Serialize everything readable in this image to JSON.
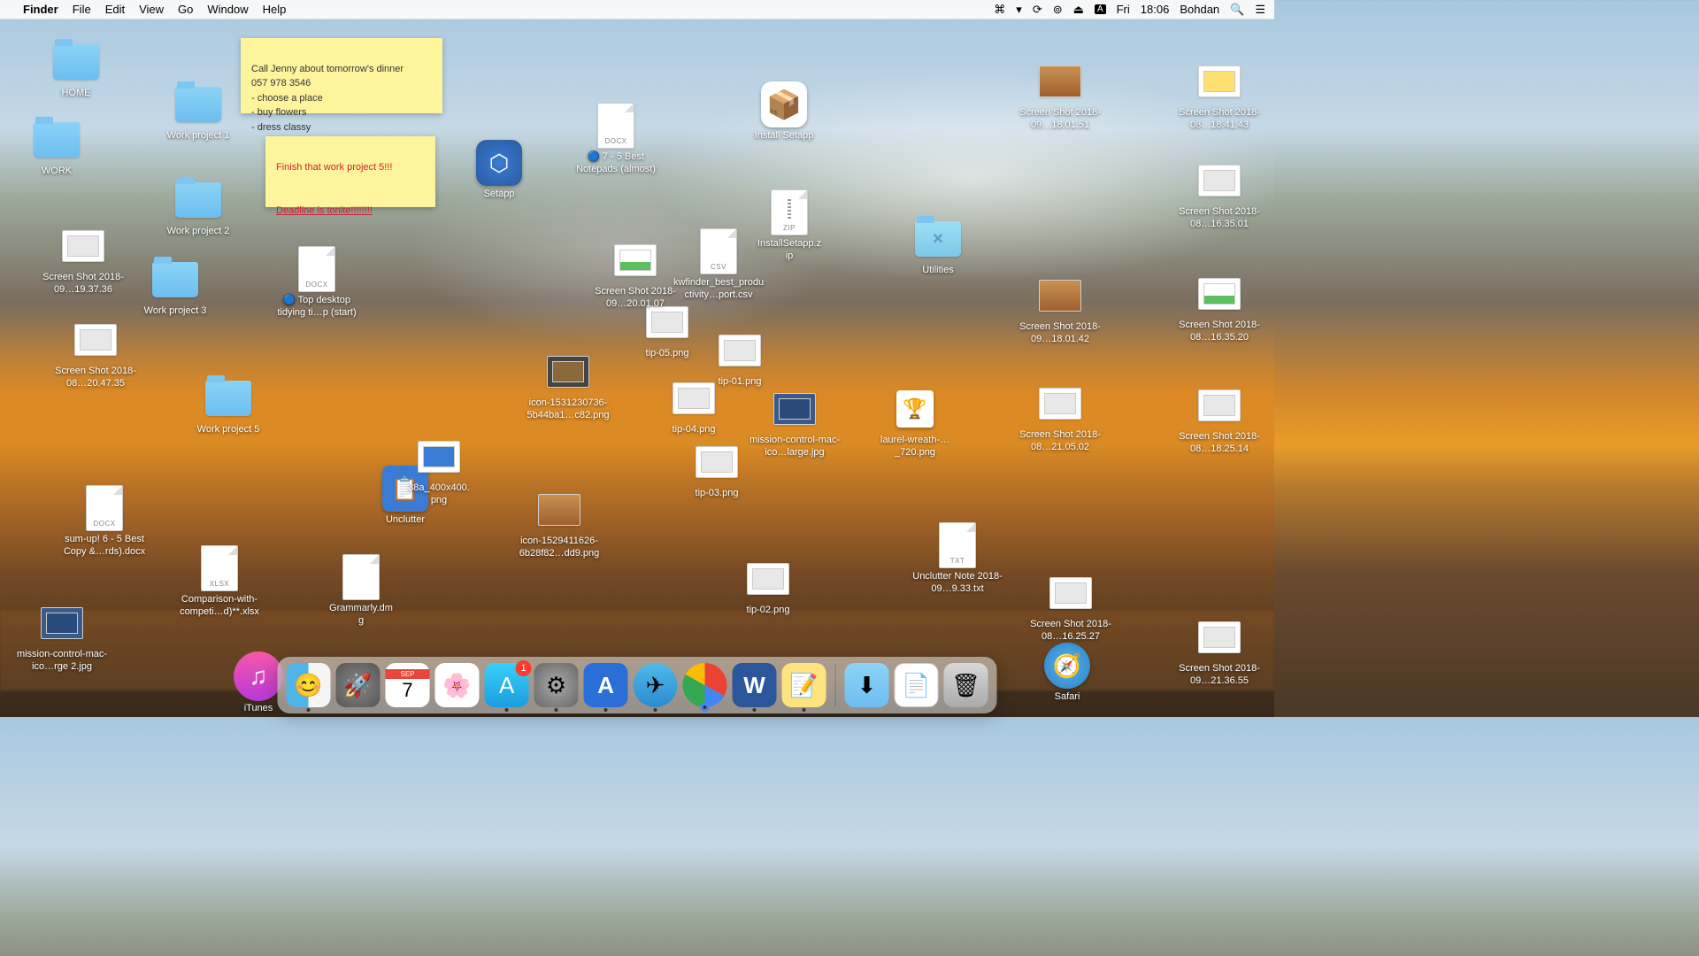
{
  "menubar": {
    "app": "Finder",
    "items": [
      "File",
      "Edit",
      "View",
      "Go",
      "Window",
      "Help"
    ],
    "day": "Fri",
    "time": "18:06",
    "user": "Bohdan",
    "input": "A"
  },
  "sticky1": "Call Jenny about tomorrow's dinner\n057 978 3546\n- choose a place\n- buy flowers\n- dress classy",
  "sticky2_line1": "Finish that work project 5!!!",
  "sticky2_line2": "Deadline is tonite!!!!!!!!",
  "folders": {
    "home": "HOME",
    "work": "WORK",
    "wp1": "Work project 1",
    "wp2": "Work project 2",
    "wp3": "Work project 3",
    "wp5": "Work project 5",
    "utilities": "Utilities"
  },
  "apps": {
    "setapp": "Setapp",
    "install_setapp": "Install Setapp",
    "unclutter": "Unclutter",
    "safari": "Safari",
    "itunes": "iTunes"
  },
  "files": {
    "notepads_docx": "🔵 7 - 5 Best Notepads (almost)",
    "top_desktop_docx": "🔵 Top desktop tidying ti…p (start)",
    "sumup_docx": "sum-up! 6 - 5 Best Copy &…rds).docx",
    "install_zip": "InstallSetapp.zip",
    "kwfinder_csv": "kwfinder_best_productivity…port.csv",
    "unclutter_txt": "Unclutter Note 2018-09…9.33.txt",
    "comparison_xlsx": "Comparison-with-competi…d)**.xlsx",
    "grammarly_dmg": "Grammarly.dmg",
    "a400_png": "38a_400x400.png",
    "icon1531_png": "icon-1531230736-5b44ba1…c82.png",
    "icon1529_png": "icon-1529411626-6b28f82…dd9.png",
    "tip01": "tip-01.png",
    "tip02": "tip-02.png",
    "tip03": "tip-03.png",
    "tip04": "tip-04.png",
    "tip05": "tip-05.png",
    "mission_large": "mission-control-mac-ico…large.jpg",
    "mission2": "mission-control-mac-ico…rge 2.jpg",
    "laurel": "laurel-wreath-…_720.png"
  },
  "screenshots": {
    "s1": "Screen Shot 2018-09…19.37.36",
    "s2": "Screen Shot 2018-08…20.47.35",
    "s3": "Screen Shot 2018-09…20.01.07",
    "s4": "Screen Shot 2018-09…18.01.51",
    "s5": "Screen Shot 2018-09…18.01.42",
    "s6": "Screen Shot 2018-08…21.05.02",
    "s7": "Screen Shot 2018-08…16.25.27",
    "s8": "Screen Shot 2018-08…18.41.43",
    "s9": "Screen Shot 2018-08…16.35.01",
    "s10": "Screen Shot 2018-08…16.35.20",
    "s11": "Screen Shot 2018-08…18.25.14",
    "s12": "Screen Shot 2018-09…21.36.55"
  },
  "dock": {
    "calendar_month": "SEP",
    "calendar_day": "7",
    "appstore_badge": "1"
  }
}
